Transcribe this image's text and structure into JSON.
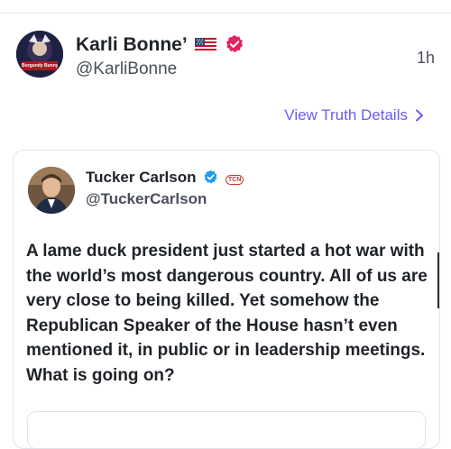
{
  "post": {
    "author_name": "Karli Bonne’",
    "author_handle": "@KarliBonne",
    "time": "1h",
    "view_details_label": "View Truth Details",
    "avatar_caption": "Burgundy Bunny"
  },
  "quoted": {
    "author_name": "Tucker Carlson",
    "author_handle": "@TuckerCarlson",
    "tcn_badge": "TCN",
    "text": "A lame duck president just started a hot war with the world’s most dangerous country. All of us are very close to being killed. Yet somehow the Republican Speaker of the House hasn’t even mentioned it, in public or in leadership meetings. What is going on?"
  },
  "colors": {
    "link": "#6b5cf0",
    "verified_badge": "#e0245e",
    "quoted_verified": "#1d9bf0"
  },
  "icons": {
    "flag": "us-flag-icon",
    "verified": "verified-badge-icon",
    "chevron": "chevron-right-icon"
  }
}
